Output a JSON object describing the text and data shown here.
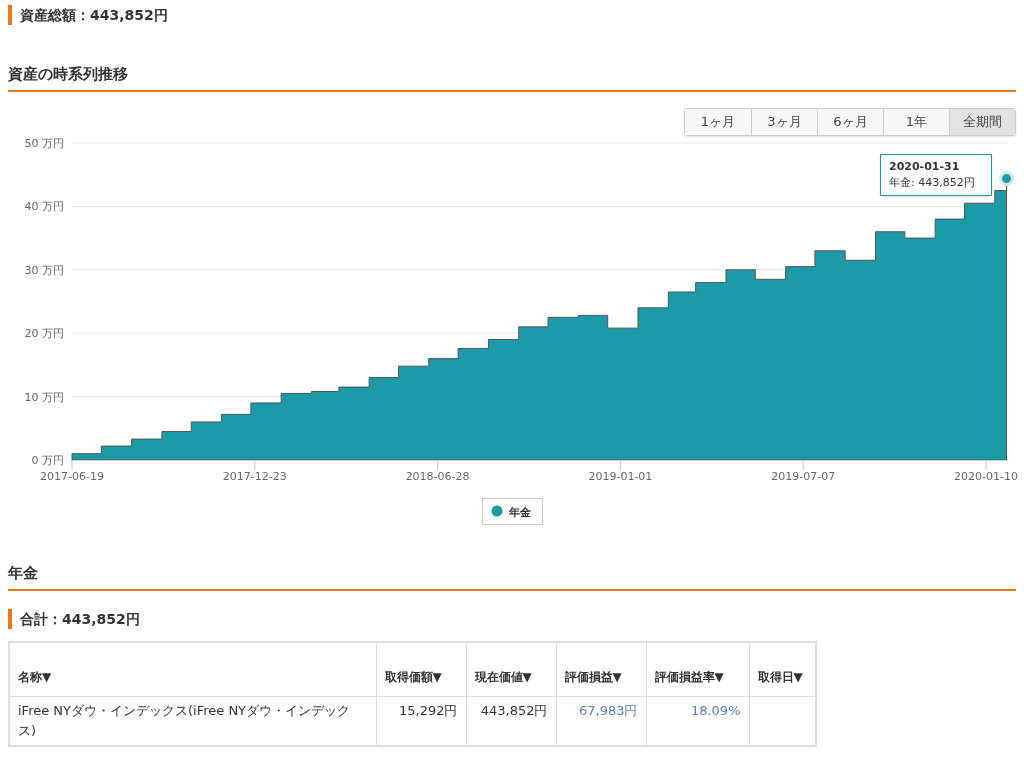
{
  "total": {
    "label": "資産総額：443,852円"
  },
  "history": {
    "title": "資産の時系列推移",
    "ranges": [
      {
        "label": "1ヶ月",
        "selected": false
      },
      {
        "label": "3ヶ月",
        "selected": false
      },
      {
        "label": "6ヶ月",
        "selected": false
      },
      {
        "label": "1年",
        "selected": false
      },
      {
        "label": "全期間",
        "selected": true
      }
    ],
    "tooltip": {
      "date": "2020-01-31",
      "text": "年金: 443,852円"
    },
    "chart_data": {
      "type": "area",
      "grid": true,
      "xlim": [
        "2017-06-19",
        "2020-01-31"
      ],
      "x": [
        "2017-06-19",
        "2017-07-19",
        "2017-08-19",
        "2017-09-19",
        "2017-10-19",
        "2017-11-19",
        "2017-12-19",
        "2018-01-19",
        "2018-02-19",
        "2018-03-19",
        "2018-04-19",
        "2018-05-19",
        "2018-06-19",
        "2018-07-19",
        "2018-08-19",
        "2018-09-19",
        "2018-10-19",
        "2018-11-19",
        "2018-12-19",
        "2019-01-19",
        "2019-02-19",
        "2019-03-19",
        "2019-04-19",
        "2019-05-19",
        "2019-06-19",
        "2019-07-19",
        "2019-08-19",
        "2019-09-19",
        "2019-10-19",
        "2019-11-19",
        "2019-12-19",
        "2020-01-19",
        "2020-01-31"
      ],
      "series": [
        {
          "name": "年金",
          "color": "#1b9aa8",
          "values": [
            1.0,
            2.2,
            3.3,
            4.5,
            6.0,
            7.2,
            9.0,
            10.5,
            10.8,
            11.5,
            13.0,
            14.8,
            16.0,
            17.6,
            19.0,
            21.0,
            22.5,
            22.8,
            20.8,
            24.0,
            26.5,
            28.0,
            30.0,
            28.5,
            30.5,
            33.0,
            31.5,
            36.0,
            35.0,
            38.0,
            40.5,
            42.5,
            44.39
          ]
        }
      ],
      "ylim": [
        0,
        50
      ],
      "yticks": [
        {
          "value": 0,
          "label": "0 万円"
        },
        {
          "value": 10,
          "label": "10 万円"
        },
        {
          "value": 20,
          "label": "20 万円"
        },
        {
          "value": 30,
          "label": "30 万円"
        },
        {
          "value": 40,
          "label": "40 万円"
        },
        {
          "value": 50,
          "label": "50 万円"
        }
      ],
      "xticks": [
        "2017-06-19",
        "2017-12-23",
        "2018-06-28",
        "2019-01-01",
        "2019-07-07",
        "2020-01-10"
      ]
    }
  },
  "pension": {
    "title": "年金",
    "subtotal": "合計：443,852円",
    "table": {
      "columns": [
        "名称▼",
        "取得価額▼",
        "現在価値▼",
        "評価損益▼",
        "評価損益率▼",
        "取得日▼"
      ],
      "rows": [
        [
          {
            "text": "iFree NYダウ・インデックス(iFree NYダウ・インデックス)",
            "kind": "name"
          },
          {
            "text": "15,292円",
            "kind": "number"
          },
          {
            "text": "443,852円",
            "kind": "number"
          },
          {
            "text": "67,983円",
            "kind": "gain"
          },
          {
            "text": "18.09%",
            "kind": "gain"
          }
        ]
      ]
    }
  }
}
